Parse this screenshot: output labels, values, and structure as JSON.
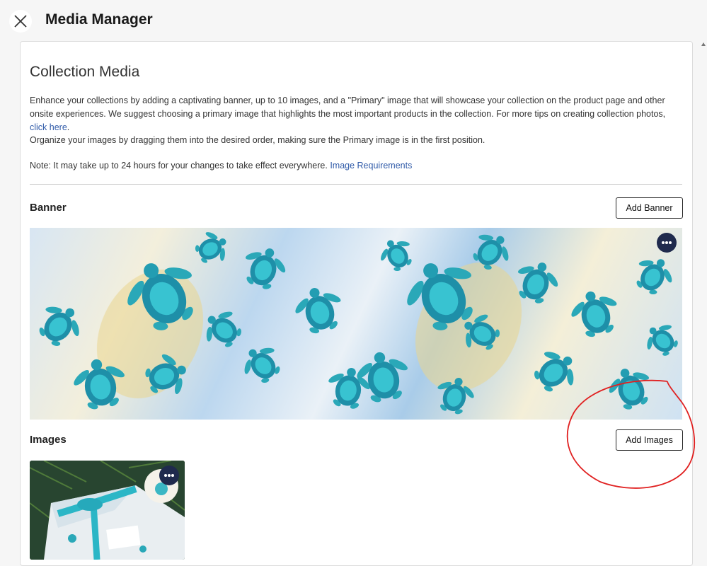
{
  "header": {
    "title": "Media Manager"
  },
  "collection": {
    "title": "Collection Media",
    "intro": "Enhance your collections by adding a captivating banner, up to 10 images, and a \"Primary\" image that will showcase your collection on the product page and other onsite experiences. We suggest choosing a primary image that highlights the most important products in the collection. For more tips on creating collection photos, ",
    "intro_link": "click here",
    "intro_end": ".",
    "organize": "Organize your images by dragging them into the desired order, making sure the Primary image is in the first position.",
    "note": "Note: It may take up to 24 hours for your changes to take effect everywhere. ",
    "note_link": "Image Requirements"
  },
  "banner": {
    "heading": "Banner",
    "add_label": "Add Banner"
  },
  "images": {
    "heading": "Images",
    "add_label": "Add Images"
  },
  "colors": {
    "accent": "#1f2a4d",
    "link": "#2f5aa8",
    "annotation": "#e02020"
  }
}
